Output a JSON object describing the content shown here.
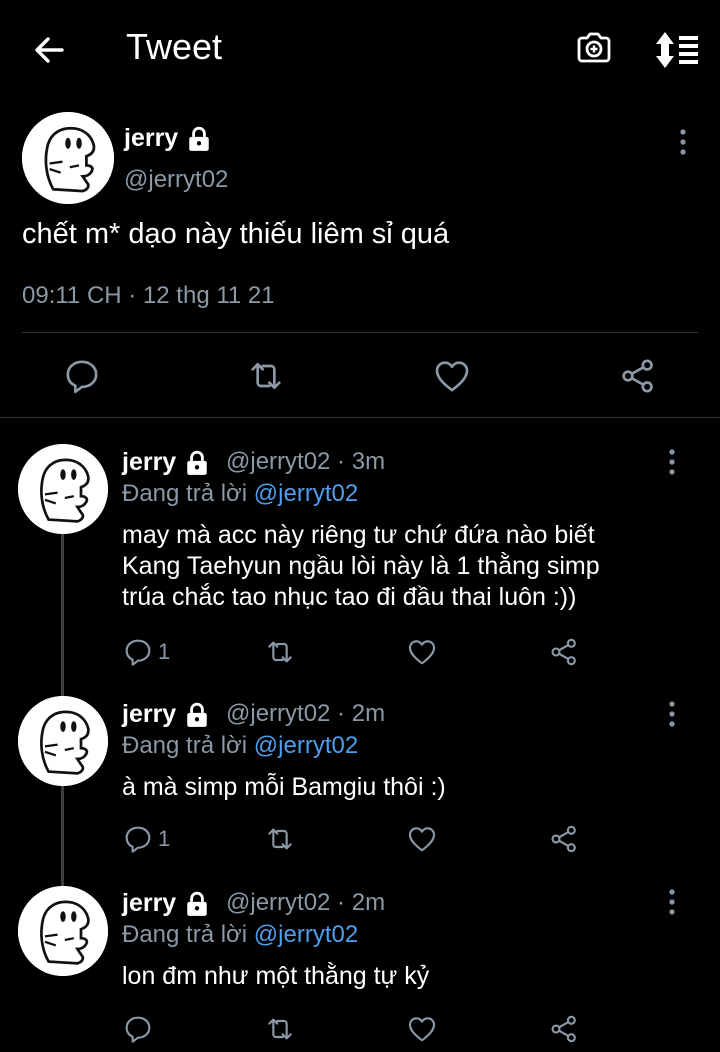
{
  "header": {
    "title": "Tweet"
  },
  "tweet": {
    "name": "jerry",
    "handle": "@jerryt02",
    "text": "chết m* dạo này thiếu liêm sỉ quá",
    "timestamp": "09:11 CH · 12 thg 11 21"
  },
  "replies": [
    {
      "name": "jerry",
      "meta": "@jerryt02 · 3m",
      "reply_prefix": "Đang trả lời ",
      "reply_mention": "@jerryt02",
      "text_lines": [
        "may mà acc này riêng tư chứ đứa nào biết",
        "Kang Taehyun ngầu lòi này là 1 thằng simp",
        "trúa chắc tao nhục tao đi đầu thai luôn :))"
      ],
      "reply_count": "1"
    },
    {
      "name": "jerry",
      "meta": "@jerryt02 · 2m",
      "reply_prefix": "Đang trả lời ",
      "reply_mention": "@jerryt02",
      "text_lines": [
        "à mà simp mỗi Bamgiu thôi :)"
      ],
      "reply_count": "1"
    },
    {
      "name": "jerry",
      "meta": "@jerryt02 · 2m",
      "reply_prefix": "Đang trả lời ",
      "reply_mention": "@jerryt02",
      "text_lines": [
        "lon đm như một thằng tự kỷ"
      ],
      "reply_count": ""
    }
  ],
  "colors": {
    "background": "#000000",
    "text": "#e7e9ea",
    "muted": "#8b98a5",
    "link": "#4f9eed"
  }
}
